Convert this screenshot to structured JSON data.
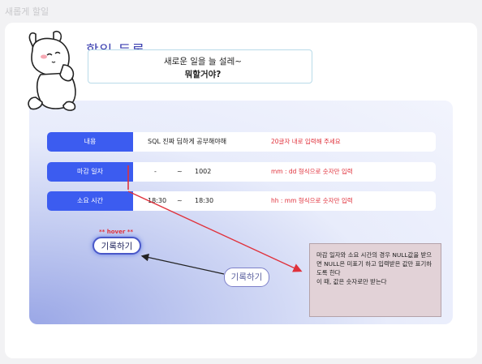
{
  "page_label": "새롭게 할일",
  "title": "할일 등록",
  "speech": [
    "새로운 일을 늘 설레~",
    "뭐할거야?"
  ],
  "rows": [
    {
      "label": "내용",
      "value": "SQL 진짜 딥하게 공부해야해",
      "hint": "20글자 내로 입력해 주세요"
    },
    {
      "label": "마감 일자",
      "from": "-",
      "tilde": "~",
      "to": "1002",
      "hint": "mm : dd 형식으로 숫자만 입력"
    },
    {
      "label": "소요 시간",
      "from": "18:30",
      "tilde": "~",
      "to": "18:30",
      "hint": "hh : mm 형식으로 숫자만 입력"
    }
  ],
  "hover_label": "** hover **",
  "button_hover_label": "기록하기",
  "button_label": "기록하기",
  "note": "마감 일자와 소요 시간의 경우 NULL값을 받으면 NULL은 미표기 하고 입력받은 값만 표기하도록 한다\n이 때, 값은 숫자로만 받는다",
  "colors": {
    "accent": "#3c5cf0",
    "title": "#3b3fb0",
    "hint": "#e0323c",
    "note_bg": "#e2d2d7"
  },
  "icons": {
    "mascot": "rabbit-mascot-icon"
  }
}
